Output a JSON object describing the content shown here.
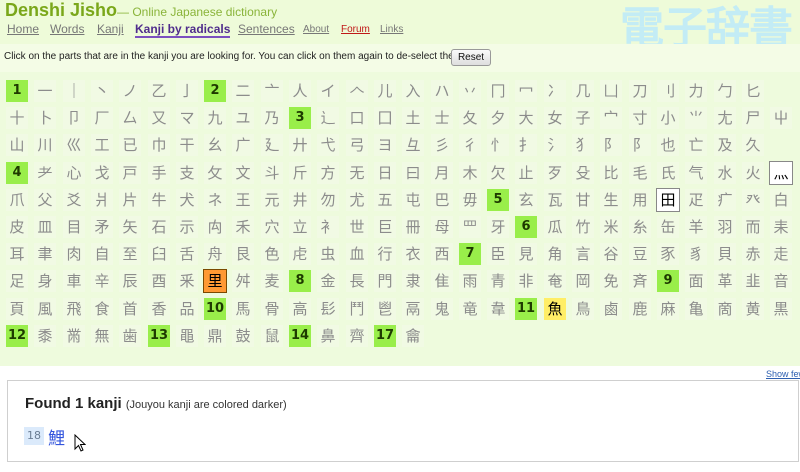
{
  "header": {
    "site_title": "Denshi Jisho",
    "tagline": "— Online Japanese dictionary",
    "watermark": "電子辞書",
    "nav": [
      {
        "label": "Home"
      },
      {
        "label": "Words"
      },
      {
        "label": "Kanji"
      },
      {
        "label": "Kanji by radicals",
        "active": true
      },
      {
        "label": "Sentences"
      },
      {
        "label": "About"
      },
      {
        "label": "Forum"
      },
      {
        "label": "Links"
      }
    ]
  },
  "instructions": {
    "text": "Click on the parts that are in the kanji you are looking for. You can click on them again to de-select them.",
    "reset_label": "Reset"
  },
  "radicals": {
    "rows": [
      [
        "#1",
        "一",
        "｜",
        "丶",
        "ノ",
        "乙",
        "亅",
        "#2",
        "二",
        "亠",
        "人",
        "イ",
        "𠆢",
        "儿",
        "入",
        "ハ",
        "丷",
        "冂",
        "冖",
        "冫",
        "几",
        "凵",
        "刀",
        "刂",
        "力",
        "勹",
        "匕"
      ],
      [
        "十",
        "卜",
        "卩",
        "厂",
        "厶",
        "又",
        "マ",
        "九",
        "ユ",
        "乃",
        "#3",
        "辶",
        "口",
        "囗",
        "土",
        "士",
        "夂",
        "夕",
        "大",
        "女",
        "子",
        "宀",
        "寸",
        "小",
        "⺌",
        "尢",
        "尸",
        "屮"
      ],
      [
        "山",
        "川",
        "巛",
        "工",
        "已",
        "巾",
        "干",
        "幺",
        "广",
        "廴",
        "廾",
        "弋",
        "弓",
        "ヨ",
        "彑",
        "彡",
        "彳",
        "忄",
        "扌",
        "氵",
        "犭",
        "阝",
        "阝",
        "也",
        "亡",
        "及",
        "久"
      ],
      [
        "#4",
        "耂",
        "心",
        "戈",
        "戸",
        "手",
        "支",
        "攵",
        "文",
        "斗",
        "斤",
        "方",
        "无",
        "日",
        "曰",
        "月",
        "木",
        "欠",
        "止",
        "歹",
        "殳",
        "比",
        "毛",
        "氏",
        "气",
        "水",
        "火",
        "灬"
      ],
      [
        "爪",
        "父",
        "爻",
        "爿",
        "片",
        "牛",
        "犬",
        "ネ",
        "王",
        "元",
        "井",
        "勿",
        "尤",
        "五",
        "屯",
        "巴",
        "毋",
        "#5",
        "玄",
        "瓦",
        "甘",
        "生",
        "用",
        "田",
        "疋",
        "疒",
        "癶",
        "白"
      ],
      [
        "皮",
        "皿",
        "目",
        "矛",
        "矢",
        "石",
        "示",
        "禸",
        "禾",
        "穴",
        "立",
        "衤",
        "世",
        "巨",
        "冊",
        "母",
        "罒",
        "牙",
        "#6",
        "瓜",
        "竹",
        "米",
        "糸",
        "缶",
        "羊",
        "羽",
        "而",
        "耒"
      ],
      [
        "耳",
        "聿",
        "肉",
        "自",
        "至",
        "臼",
        "舌",
        "舟",
        "艮",
        "色",
        "虍",
        "虫",
        "血",
        "行",
        "衣",
        "西",
        "#7",
        "臣",
        "見",
        "角",
        "言",
        "谷",
        "豆",
        "豕",
        "豸",
        "貝",
        "赤",
        "走"
      ],
      [
        "足",
        "身",
        "車",
        "辛",
        "辰",
        "酉",
        "釆",
        "里",
        "舛",
        "麦",
        "#8",
        "金",
        "長",
        "門",
        "隶",
        "隹",
        "雨",
        "青",
        "非",
        "奄",
        "岡",
        "免",
        "斉",
        "#9",
        "面",
        "革",
        "韭",
        "音"
      ],
      [
        "頁",
        "風",
        "飛",
        "食",
        "首",
        "香",
        "品",
        "#10",
        "馬",
        "骨",
        "高",
        "髟",
        "鬥",
        "鬯",
        "鬲",
        "鬼",
        "竜",
        "韋",
        "#11",
        "魚",
        "鳥",
        "鹵",
        "鹿",
        "麻",
        "亀",
        "啇",
        "黄",
        "黒"
      ],
      [
        "#12",
        "黍",
        "黹",
        "無",
        "歯",
        "#13",
        "黽",
        "鼎",
        "鼓",
        "鼠",
        "#14",
        "鼻",
        "齊",
        "#17",
        "龠"
      ]
    ],
    "selected": [
      "里"
    ],
    "highlighted": [
      "灬",
      "田"
    ],
    "highlighted_yellow": [
      "魚"
    ]
  },
  "show_link": "Show few",
  "results": {
    "title": "Found 1 kanji",
    "note": "(Jouyou kanji are colored darker)",
    "items": [
      {
        "strokes": "18",
        "kanji": "鯉"
      }
    ]
  },
  "colors": {
    "accent": "#7aa71a",
    "stroke_header": "#99ee4a",
    "selected": "#ff9933",
    "result_kanji": "#3355dd"
  }
}
